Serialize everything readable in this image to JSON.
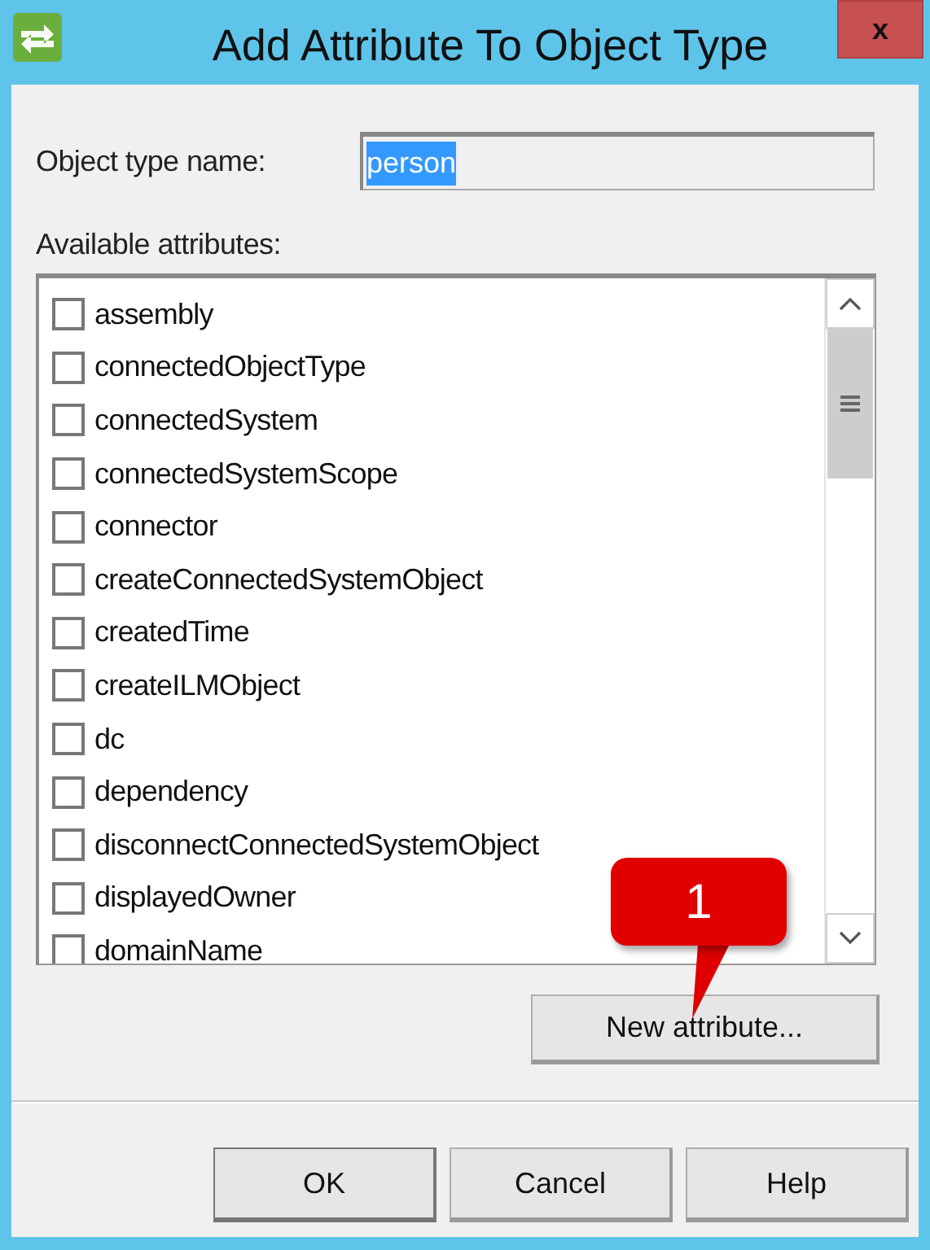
{
  "window": {
    "title": "Add Attribute To Object Type",
    "close": "x"
  },
  "object_type": {
    "label": "Object type name:",
    "value": "person",
    "text_selected": true
  },
  "attributes": {
    "label": "Available attributes:",
    "items": [
      {
        "label": "assembly",
        "checked": false
      },
      {
        "label": "connectedObjectType",
        "checked": false
      },
      {
        "label": "connectedSystem",
        "checked": false
      },
      {
        "label": "connectedSystemScope",
        "checked": false
      },
      {
        "label": "connector",
        "checked": false
      },
      {
        "label": "createConnectedSystemObject",
        "checked": false
      },
      {
        "label": "createdTime",
        "checked": false
      },
      {
        "label": "createILMObject",
        "checked": false
      },
      {
        "label": "dc",
        "checked": false
      },
      {
        "label": "dependency",
        "checked": false
      },
      {
        "label": "disconnectConnectedSystemObject",
        "checked": false
      },
      {
        "label": "displayedOwner",
        "checked": false
      },
      {
        "label": "domainName",
        "checked": false
      }
    ]
  },
  "new_attribute_button": "New attribute...",
  "callout": "1",
  "buttons": [
    "OK",
    "Cancel",
    "Help"
  ]
}
